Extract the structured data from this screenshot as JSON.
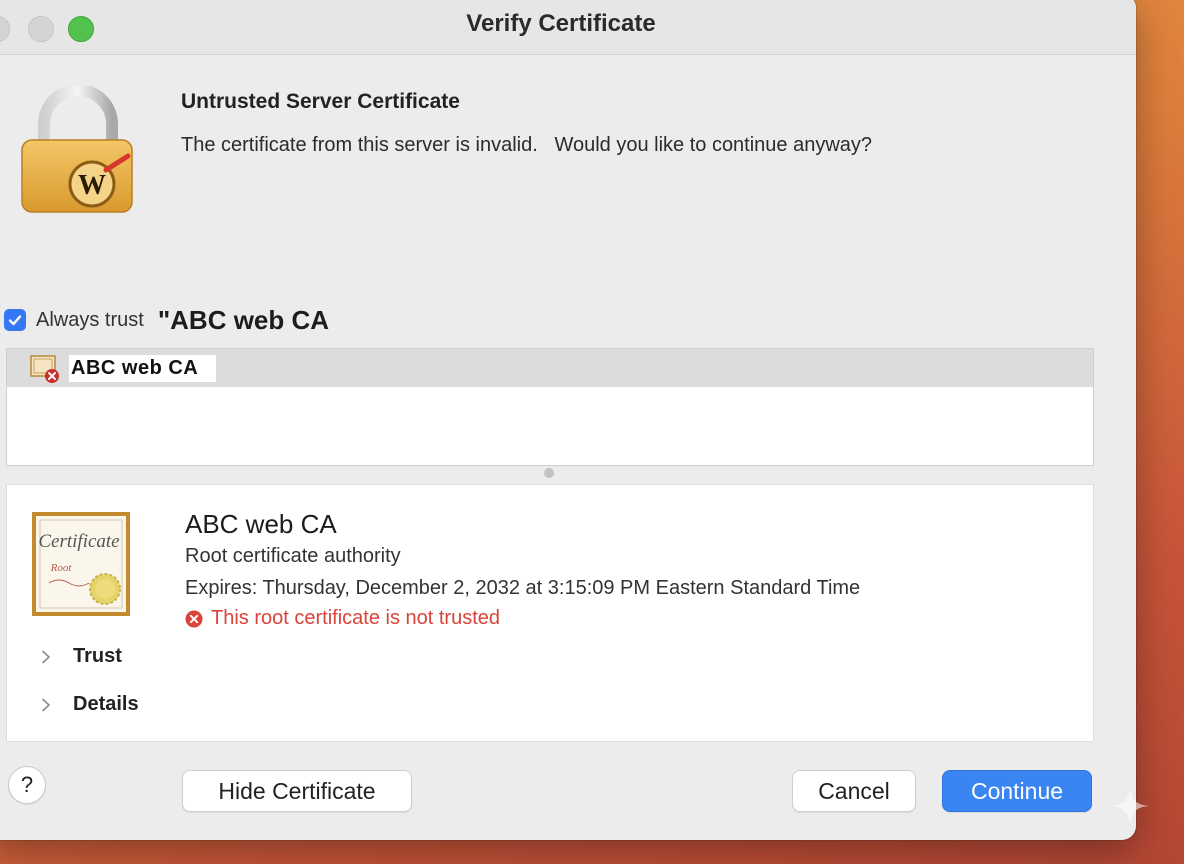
{
  "window": {
    "title": "Verify Certificate"
  },
  "header": {
    "title": "Untrusted Server Certificate",
    "message": "The certificate from this server is invalid.   Would you like to continue anyway?"
  },
  "trust_option": {
    "label": "Always trust",
    "name": "\"ABC web CA",
    "checked": true
  },
  "cert_list": {
    "items": [
      {
        "label": "ABC web CA",
        "icon": "certificate-error-icon"
      }
    ]
  },
  "cert_detail": {
    "name": "ABC web CA",
    "kind": "Root certificate authority",
    "expires": "Expires: Thursday, December 2, 2032 at 3:15:09 PM Eastern Standard Time",
    "warning": "This root certificate is not trusted",
    "sections": [
      "Trust",
      "Details"
    ]
  },
  "buttons": {
    "help": "?",
    "hide_certificate": "Hide Certificate",
    "cancel": "Cancel",
    "continue": "Continue"
  },
  "colors": {
    "accent": "#3a85f2",
    "warning": "#d9433a",
    "traffic_green": "#53c24c"
  }
}
